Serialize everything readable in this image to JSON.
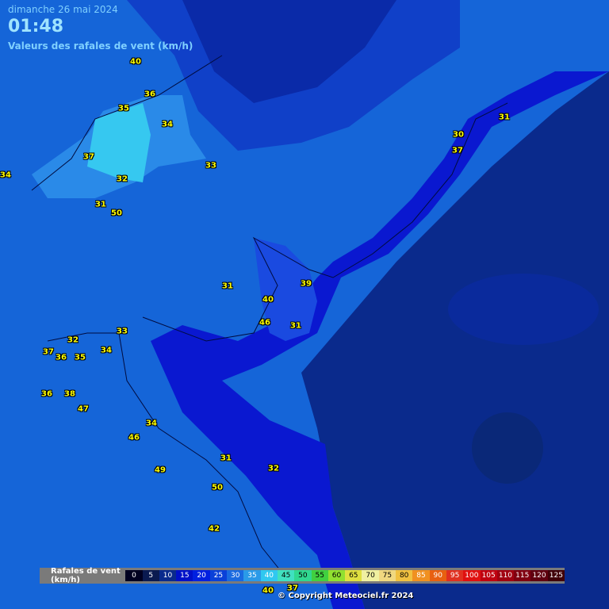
{
  "header": {
    "date": "dimanche 26 mai 2024",
    "time": "01:48",
    "subtitle": "Valeurs des rafales de vent (km/h)"
  },
  "gust_readings": [
    {
      "value": "40"
    },
    {
      "value": "36"
    },
    {
      "value": "35"
    },
    {
      "value": "34"
    },
    {
      "value": "37"
    },
    {
      "value": "32"
    },
    {
      "value": "33"
    },
    {
      "value": "34"
    },
    {
      "value": "31"
    },
    {
      "value": "50"
    },
    {
      "value": "30"
    },
    {
      "value": "37"
    },
    {
      "value": "31"
    },
    {
      "value": "39"
    },
    {
      "value": "31"
    },
    {
      "value": "40"
    },
    {
      "value": "46"
    },
    {
      "value": "31"
    },
    {
      "value": "33"
    },
    {
      "value": "32"
    },
    {
      "value": "37"
    },
    {
      "value": "36"
    },
    {
      "value": "35"
    },
    {
      "value": "34"
    },
    {
      "value": "36"
    },
    {
      "value": "38"
    },
    {
      "value": "47"
    },
    {
      "value": "34"
    },
    {
      "value": "46"
    },
    {
      "value": "49"
    },
    {
      "value": "31"
    },
    {
      "value": "32"
    },
    {
      "value": "50"
    },
    {
      "value": "42"
    },
    {
      "value": "40"
    },
    {
      "value": "37"
    }
  ],
  "legend": {
    "title": "Rafales de vent (km/h)",
    "steps": [
      {
        "label": "0",
        "color": "#000020",
        "text": "#ffffff"
      },
      {
        "label": "5",
        "color": "#0a1a50",
        "text": "#ffffff"
      },
      {
        "label": "10",
        "color": "#0a2a8c",
        "text": "#ffffff"
      },
      {
        "label": "15",
        "color": "#0010c8",
        "text": "#ffffff"
      },
      {
        "label": "20",
        "color": "#0020e0",
        "text": "#ffffff"
      },
      {
        "label": "25",
        "color": "#0a40d8",
        "text": "#ffffff"
      },
      {
        "label": "30",
        "color": "#1a6ae0",
        "text": "#ffffff"
      },
      {
        "label": "35",
        "color": "#2a9ae8",
        "text": "#ffffff"
      },
      {
        "label": "40",
        "color": "#30c8f0",
        "text": "#ffffff"
      },
      {
        "label": "45",
        "color": "#40e0c0",
        "text": "#000000"
      },
      {
        "label": "50",
        "color": "#30d890",
        "text": "#000000"
      },
      {
        "label": "55",
        "color": "#40d040",
        "text": "#000000"
      },
      {
        "label": "60",
        "color": "#90e030",
        "text": "#000000"
      },
      {
        "label": "65",
        "color": "#e0e040",
        "text": "#000000"
      },
      {
        "label": "70",
        "color": "#f0f0a0",
        "text": "#000000"
      },
      {
        "label": "75",
        "color": "#f0d880",
        "text": "#000000"
      },
      {
        "label": "80",
        "color": "#f0c040",
        "text": "#000000"
      },
      {
        "label": "85",
        "color": "#f09020",
        "text": "#ffffff"
      },
      {
        "label": "90",
        "color": "#e86010",
        "text": "#ffffff"
      },
      {
        "label": "95",
        "color": "#e03020",
        "text": "#ffffff"
      },
      {
        "label": "100",
        "color": "#e01010",
        "text": "#ffffff"
      },
      {
        "label": "105",
        "color": "#c00010",
        "text": "#ffffff"
      },
      {
        "label": "110",
        "color": "#a00010",
        "text": "#ffffff"
      },
      {
        "label": "115",
        "color": "#800010",
        "text": "#ffffff"
      },
      {
        "label": "120",
        "color": "#600010",
        "text": "#ffffff"
      },
      {
        "label": "125",
        "color": "#400008",
        "text": "#ffffff"
      }
    ]
  },
  "copyright": "© Copyright Meteociel.fr 2024"
}
